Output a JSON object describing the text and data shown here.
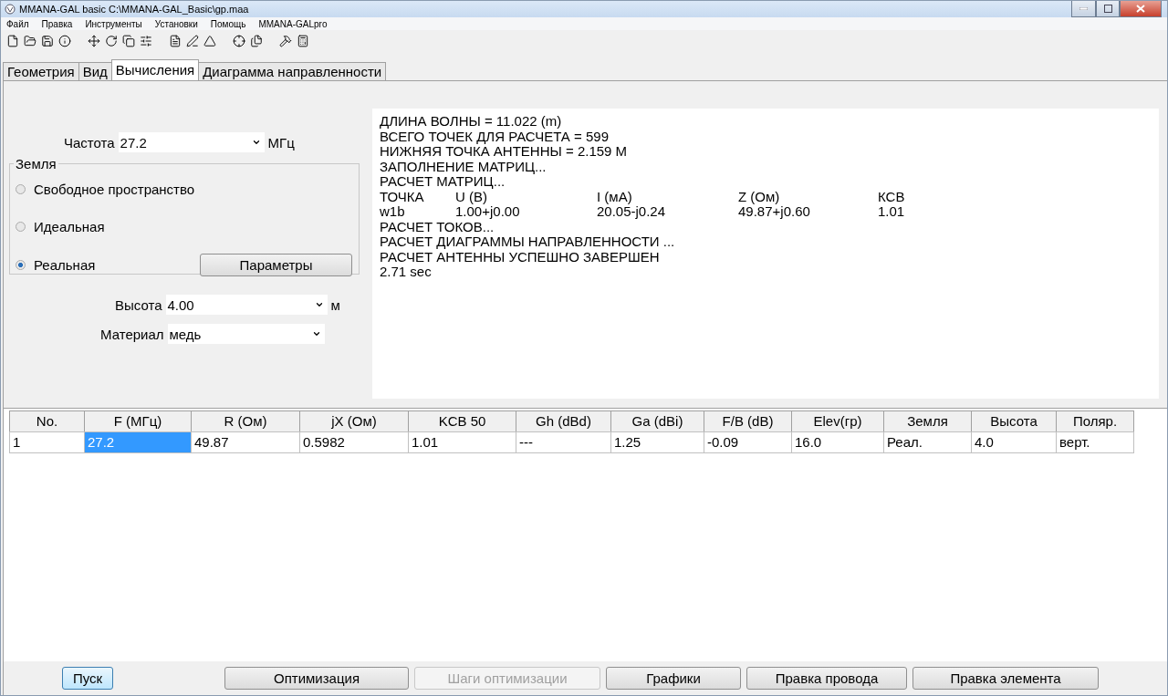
{
  "window": {
    "title": "MMANA-GAL basic C:\\MMANA-GAL_Basic\\gp.maa"
  },
  "menu": [
    "Файл",
    "Правка",
    "Инструменты",
    "Установки",
    "Помощь",
    "MMANA-GALpro"
  ],
  "tabs": [
    {
      "label": "Геометрия",
      "selected": false
    },
    {
      "label": "Вид",
      "selected": false
    },
    {
      "label": "Вычисления",
      "selected": true
    },
    {
      "label": "Диаграмма направленности",
      "selected": false
    }
  ],
  "frequency": {
    "label": "Частота",
    "value": "27.2",
    "unit": "МГц"
  },
  "ground": {
    "title": "Земля",
    "options": [
      {
        "label": "Свободное пространство",
        "selected": false
      },
      {
        "label": "Идеальная",
        "selected": false
      },
      {
        "label": "Реальная",
        "selected": true,
        "button": "Параметры"
      }
    ]
  },
  "height": {
    "label": "Высота",
    "value": "4.00",
    "unit": "м"
  },
  "material": {
    "label": "Материал",
    "value": "медь"
  },
  "output": [
    {
      "kind": "text",
      "text": "ДЛИНА ВОЛНЫ = 11.022 (m)"
    },
    {
      "kind": "text",
      "text": "ВСЕГО ТОЧЕК ДЛЯ РАСЧЕТА = 599"
    },
    {
      "kind": "text",
      "text": "НИЖНЯЯ ТОЧКА АНТЕННЫ = 2.159 М"
    },
    {
      "kind": "text",
      "text": "ЗАПОЛНЕНИЕ МАТРИЦ..."
    },
    {
      "kind": "text",
      "text": "РАСЧЕТ МАТРИЦ..."
    },
    {
      "kind": "columns",
      "cells": [
        "ТОЧКА",
        "U (B)",
        "I (мА)",
        "Z (Ом)",
        "КСВ"
      ]
    },
    {
      "kind": "columns",
      "cells": [
        "w1b",
        "1.00+j0.00",
        "20.05-j0.24",
        "49.87+j0.60",
        "1.01"
      ]
    },
    {
      "kind": "text",
      "text": "РАСЧЕТ ТОКОВ..."
    },
    {
      "kind": "text",
      "text": "РАСЧЕТ ДИАГРАММЫ НАПРАВЛЕННОСТИ ..."
    },
    {
      "kind": "text",
      "text": "РАСЧЕТ АНТЕННЫ УСПЕШНО ЗАВЕРШЕН"
    },
    {
      "kind": "text",
      "text": "2.71 sec"
    }
  ],
  "table": {
    "columns": [
      "No.",
      "F (МГц)",
      "R (Ом)",
      "jX (Ом)",
      "KCB 50",
      "Gh (dBd)",
      "Ga (dBi)",
      "F/B (dB)",
      "Elev(гр)",
      "Земля",
      "Высота",
      "Поляр."
    ],
    "rows": [
      {
        "cells": [
          {
            "text": "1",
            "selected": false
          },
          {
            "text": "27.2",
            "selected": true
          },
          {
            "text": "49.87",
            "selected": false
          },
          {
            "text": "0.5982",
            "selected": false
          },
          {
            "text": "1.01",
            "selected": false
          },
          {
            "text": "---",
            "selected": false
          },
          {
            "text": "1.25",
            "selected": false
          },
          {
            "text": "-0.09",
            "selected": false
          },
          {
            "text": "16.0",
            "selected": false
          },
          {
            "text": "Реал.",
            "selected": false
          },
          {
            "text": "4.0",
            "selected": false
          },
          {
            "text": "верт.",
            "selected": false
          }
        ]
      }
    ]
  },
  "buttons": [
    {
      "label": "Пуск",
      "disabled": false,
      "focused": true
    },
    {
      "label": "Оптимизация",
      "disabled": false,
      "focused": false
    },
    {
      "label": "Шаги оптимизации",
      "disabled": true,
      "focused": false
    },
    {
      "label": "Графики",
      "disabled": false,
      "focused": false
    },
    {
      "label": "Правка провода",
      "disabled": false,
      "focused": false
    },
    {
      "label": "Правка элемента",
      "disabled": false,
      "focused": false
    }
  ]
}
